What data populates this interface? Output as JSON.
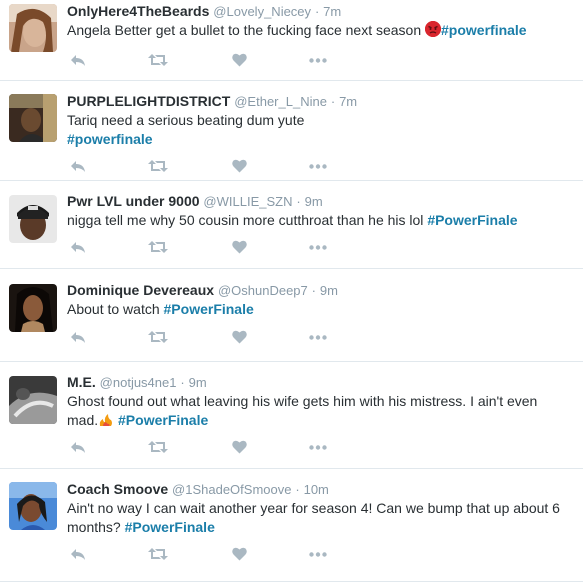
{
  "colors": {
    "hashtag": "#1b7ea9",
    "name": "#292f33",
    "meta": "#8899a6",
    "icon": "#aab8c2",
    "divider": "#e1e8ed"
  },
  "icons": {
    "reply": "reply-icon",
    "retweet": "retweet-icon",
    "like": "heart-icon",
    "more": "more-icon"
  },
  "tweets": [
    {
      "name": "OnlyHere4TheBeards",
      "handle": "@Lovely_Niecey",
      "time": "7m",
      "text_before": "Angela Better get a bullet to the fucking face next season ",
      "emoji": "angry-face",
      "hashtag": "#powerfinale",
      "text_after": ""
    },
    {
      "name": "PURPLELIGHTDISTRICT",
      "handle": "@Ether_L_Nine",
      "time": "7m",
      "text_before": "Tariq need a serious beating dum yute",
      "hashtag": "#powerfinale",
      "text_after": ""
    },
    {
      "name": "Pwr LVL under 9000",
      "handle": "@WILLIE_SZN",
      "time": "9m",
      "text_before": "nigga tell me why 50 cousin more cutthroat than he his lol ",
      "hashtag": "#PowerFinale",
      "text_after": ""
    },
    {
      "name": "Dominique Devereaux",
      "handle": "@OshunDeep7",
      "time": "9m",
      "text_before": "About to watch ",
      "hashtag": "#PowerFinale",
      "text_after": ""
    },
    {
      "name": "M.E.",
      "handle": "@notjus4ne1",
      "time": "9m",
      "text_before": "Ghost found out what leaving his wife gets him with his mistress. I ain't even mad.",
      "emoji": "fire",
      "hashtag": "#PowerFinale",
      "text_after": ""
    },
    {
      "name": "Coach Smoove",
      "handle": "@1ShadeOfSmoove",
      "time": "10m",
      "text_before": "Ain't no way I can wait another year for season 4! Can we bump that up about 6 months? ",
      "hashtag": "#PowerFinale",
      "text_after": ""
    }
  ],
  "separator": "·"
}
